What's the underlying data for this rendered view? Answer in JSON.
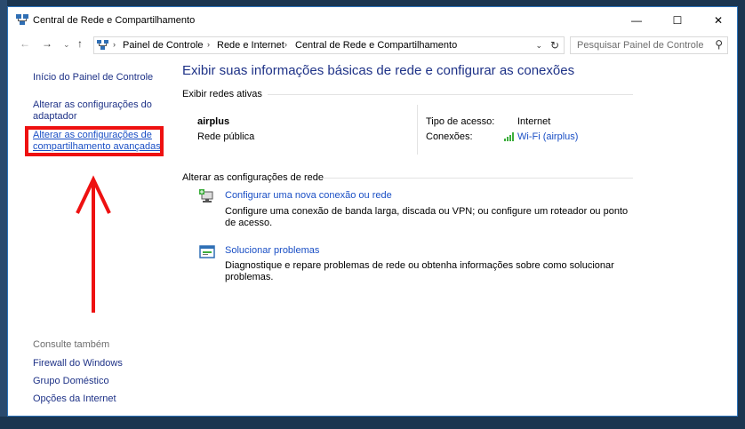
{
  "window": {
    "title": "Central de Rede e Compartilhamento",
    "controls": {
      "minimize": "—",
      "maximize": "☐",
      "close": "✕"
    }
  },
  "nav": {
    "back": "←",
    "forward": "→",
    "recent": "⌄",
    "up": "↑",
    "breadcrumbs": [
      "Painel de Controle",
      "Rede e Internet",
      "Central de Rede e Compartilhamento"
    ],
    "separator": "›",
    "dropdown": "⌄",
    "refresh": "↻",
    "search_placeholder": "Pesquisar Painel de Controle",
    "search_icon": "⚲"
  },
  "sidebar": {
    "home": "Início do Painel de Controle",
    "adapter": "Alterar as configurações do adaptador",
    "advanced": "Alterar as configurações de compartilhamento avançadas",
    "see_also_title": "Consulte também",
    "see_also": [
      "Firewall do Windows",
      "Grupo Doméstico",
      "Opções da Internet"
    ]
  },
  "main": {
    "title": "Exibir suas informações básicas de rede e configurar as conexões",
    "active_networks": {
      "title": "Exibir redes ativas",
      "name": "airplus",
      "type": "Rede pública",
      "access_label": "Tipo de acesso:",
      "access_value": "Internet",
      "connections_label": "Conexões:",
      "connections_value": "Wi-Fi (airplus)"
    },
    "change_settings": {
      "title": "Alterar as configurações de rede",
      "tasks": [
        {
          "link": "Configurar uma nova conexão ou rede",
          "desc": "Configure uma conexão de banda larga, discada ou VPN; ou configure um roteador ou ponto de acesso."
        },
        {
          "link": "Solucionar problemas",
          "desc": "Diagnostique e repare problemas de rede ou obtenha informações sobre como solucionar problemas."
        }
      ]
    }
  },
  "colors": {
    "link": "#1e3287",
    "highlight": "#ee1111",
    "wifi": "#1a4fc5"
  }
}
